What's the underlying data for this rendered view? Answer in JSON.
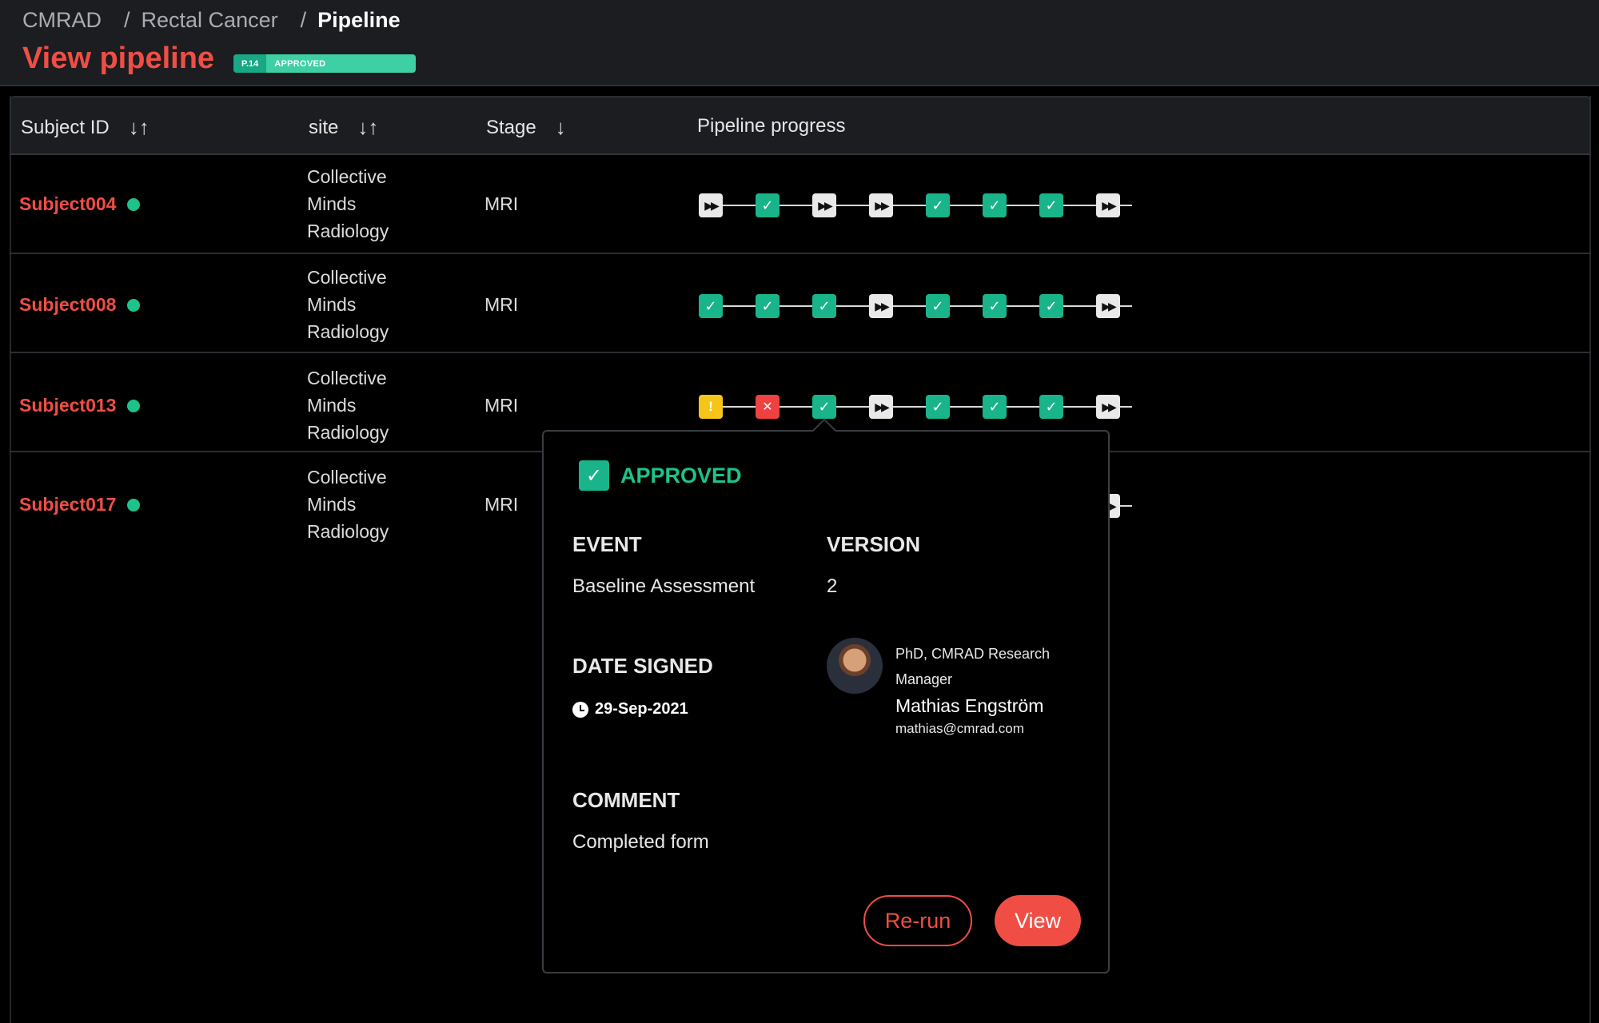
{
  "breadcrumb": [
    "CMRAD",
    "Rectal Cancer",
    "Pipeline"
  ],
  "page_title": "View pipeline",
  "badge": {
    "version": "P.14",
    "status": "APPROVED"
  },
  "columns": {
    "subject_id": "Subject ID",
    "site": "site",
    "stage": "Stage",
    "progress": "Pipeline progress"
  },
  "sort_icons": {
    "subject_id": "↓↑",
    "site": "↓↑",
    "stage": "↓"
  },
  "rows": [
    {
      "subject": "Subject004",
      "site": [
        "Collective",
        "Minds",
        "Radiology"
      ],
      "stage": "MRI",
      "steps": [
        "skip",
        "ok",
        "skip",
        "skip",
        "ok",
        "ok",
        "ok",
        "skip"
      ]
    },
    {
      "subject": "Subject008",
      "site": [
        "Collective",
        "Minds",
        "Radiology"
      ],
      "stage": "MRI",
      "steps": [
        "ok",
        "ok",
        "ok",
        "skip",
        "ok",
        "ok",
        "ok",
        "skip"
      ]
    },
    {
      "subject": "Subject013",
      "site": [
        "Collective",
        "Minds",
        "Radiology"
      ],
      "stage": "MRI",
      "steps": [
        "warn",
        "fail",
        "ok",
        "skip",
        "ok",
        "ok",
        "ok",
        "skip"
      ]
    },
    {
      "subject": "Subject017",
      "site": [
        "Collective",
        "Minds",
        "Radiology"
      ],
      "stage": "MRI",
      "steps": [
        "skip",
        "ok",
        "skip",
        "skip",
        "ok",
        "ok",
        "ok",
        "skip"
      ]
    }
  ],
  "popover": {
    "status": "APPROVED",
    "event_label": "EVENT",
    "event_value": "Baseline Assessment",
    "version_label": "VERSION",
    "version_value": "2",
    "date_label": "DATE SIGNED",
    "date_value": "29-Sep-2021",
    "signer_role": "PhD, CMRAD Research Manager",
    "signer_name": "Mathias Engström",
    "signer_email": "mathias@cmrad.com",
    "comment_label": "COMMENT",
    "comment_value": "Completed form",
    "rerun_label": "Re-run",
    "view_label": "View"
  },
  "colors": {
    "accent": "#f04e45",
    "success": "#19b48a",
    "warning": "#f5c518",
    "error": "#ef4141",
    "skip": "#e9e9ea"
  },
  "icons": {
    "ok": "check-icon",
    "skip": "fast-forward-icon",
    "warn": "warning-icon",
    "fail": "close-icon"
  }
}
